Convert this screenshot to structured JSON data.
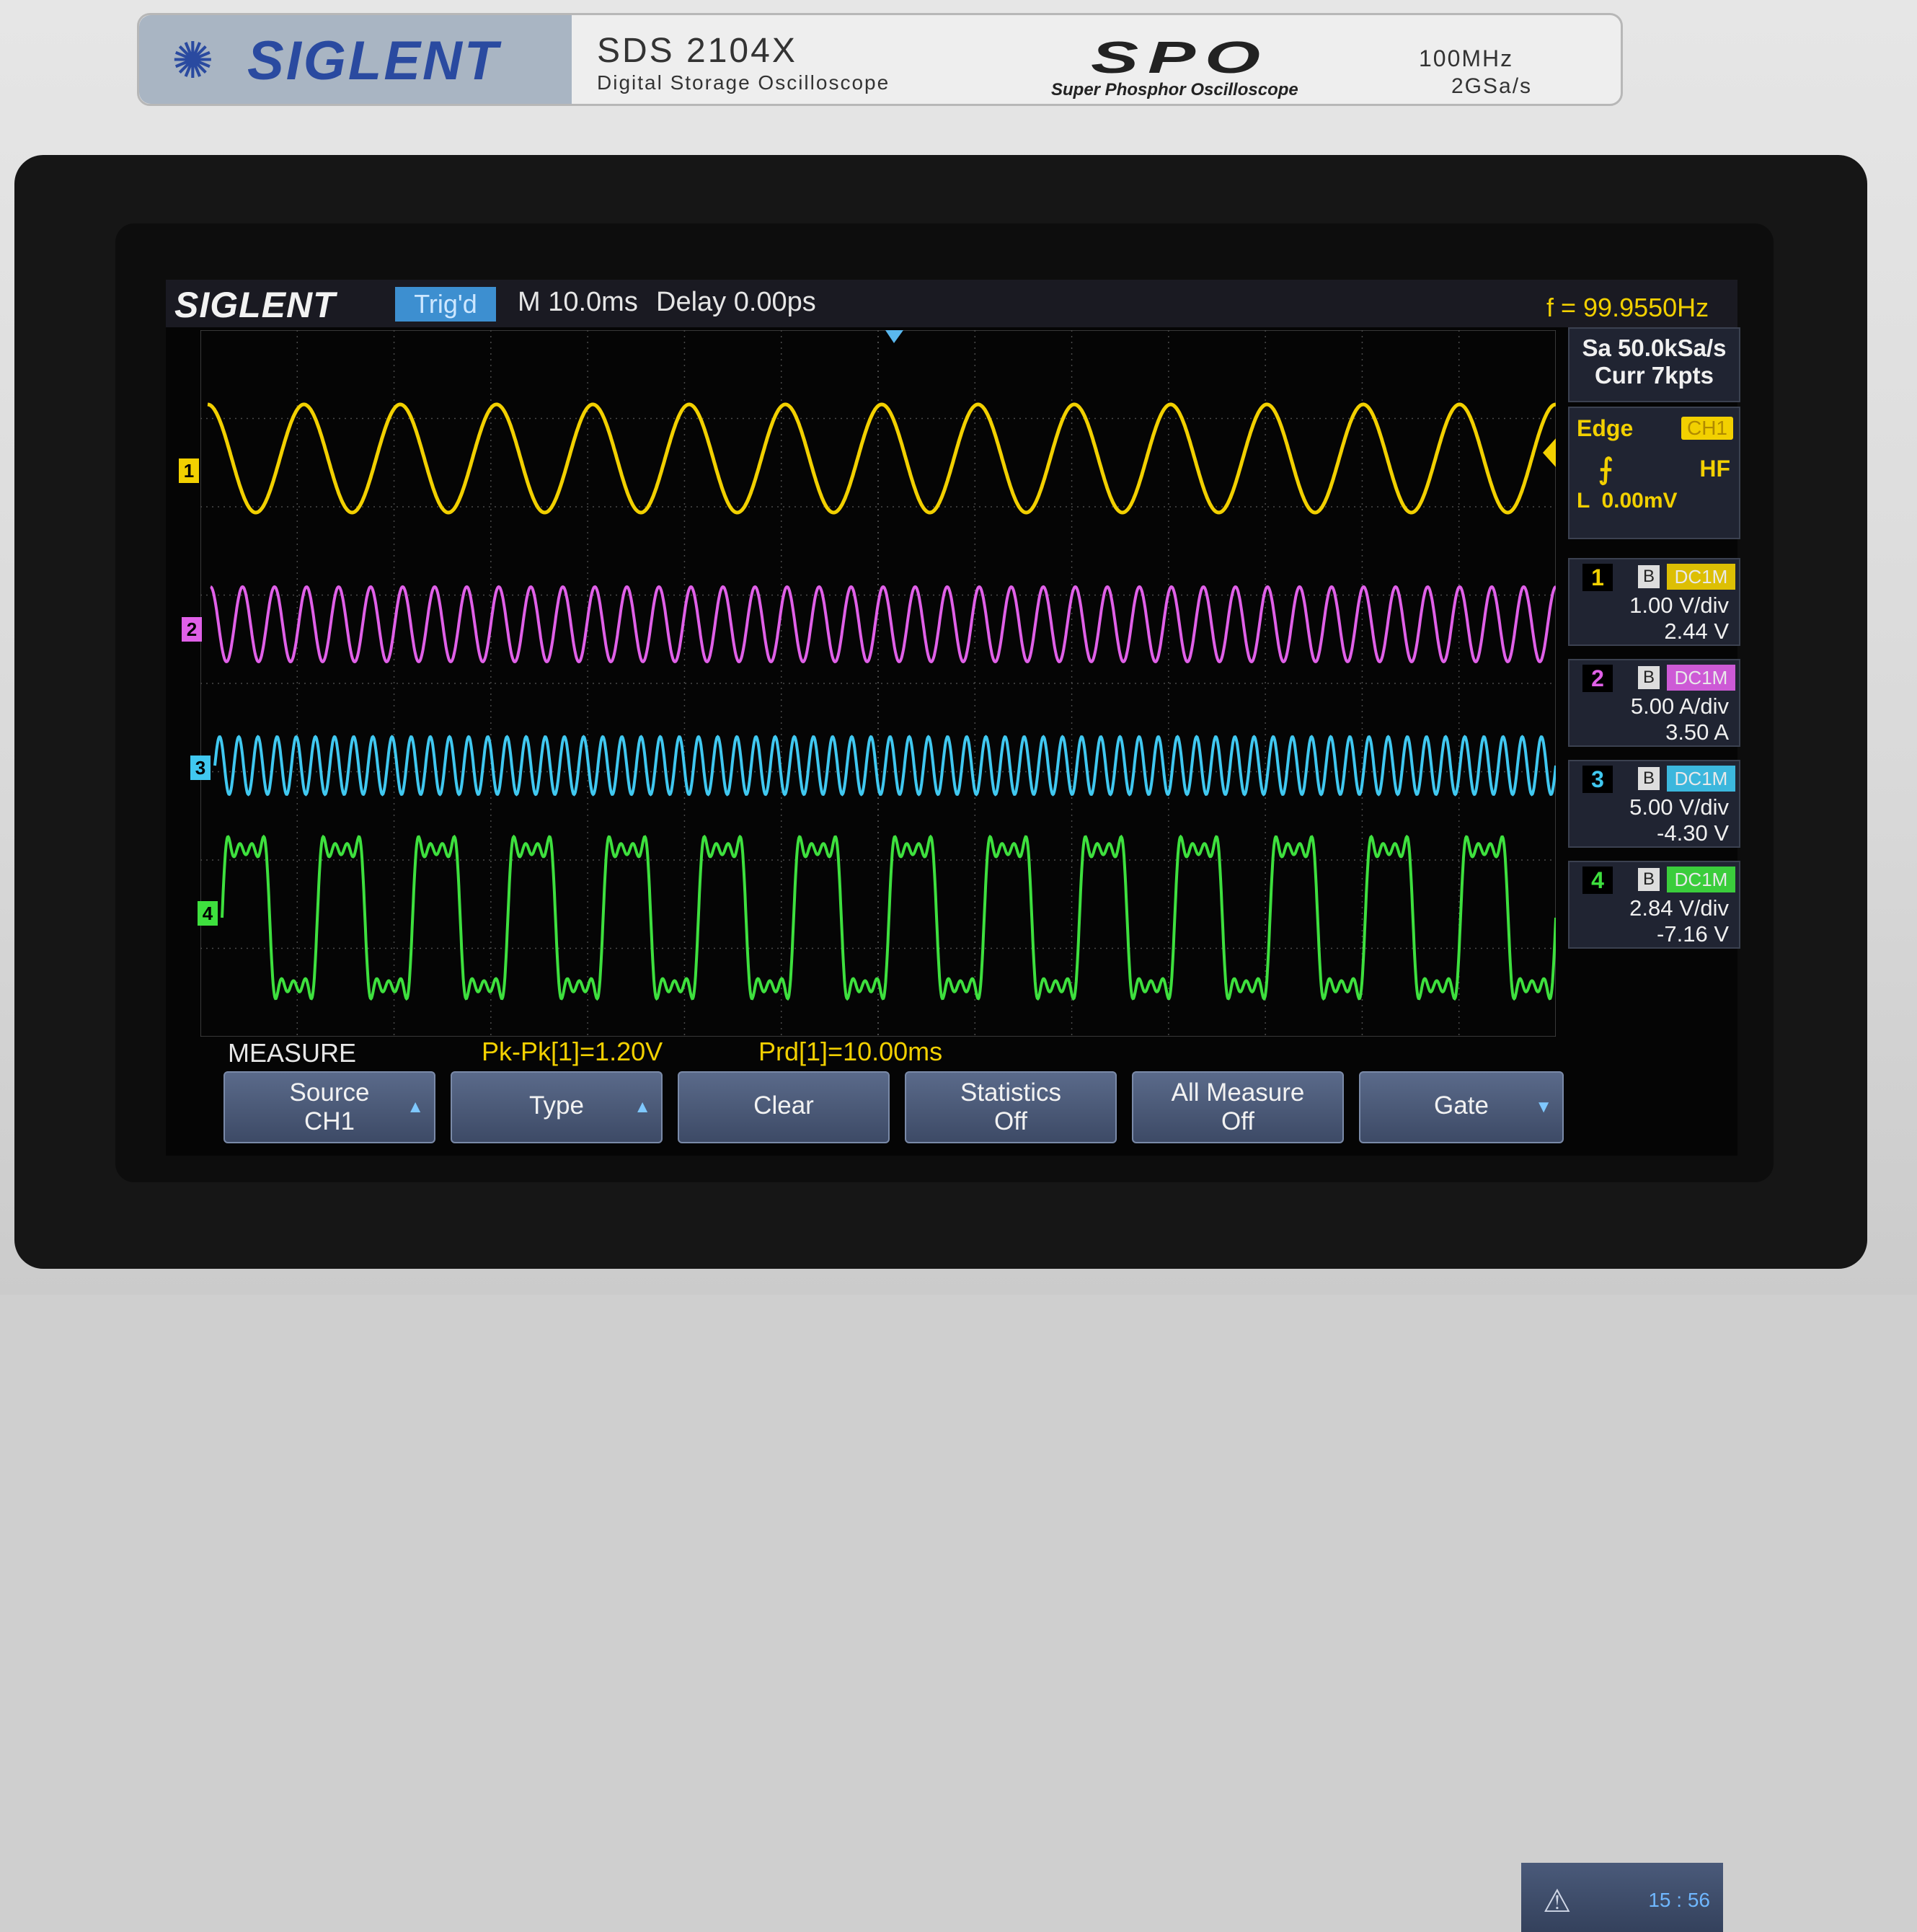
{
  "bezel": {
    "brand": "SIGLENT",
    "model": "SDS 2104X",
    "model_subtitle": "Digital Storage Oscilloscope",
    "spo": "SPO",
    "spo_tagline": "Super Phosphor Oscilloscope",
    "bandwidth": "100MHz",
    "sample_rate": "2GSa/s"
  },
  "status": {
    "logo": "SIGLENT",
    "trigger_state": "Trig'd",
    "timebase": "M 10.0ms",
    "delay": "Delay 0.00ps",
    "frequency": "f = 99.9550Hz"
  },
  "acquisition": {
    "sa": "Sa 50.0kSa/s",
    "curr": "Curr 7kpts"
  },
  "trigger": {
    "type": "Edge",
    "source": "CH1",
    "slope_icon": "rising-edge-icon",
    "coupling": "HF",
    "level": "L  0.00mV"
  },
  "channels": [
    {
      "num": "1",
      "b": "B",
      "coupling": "DC1M",
      "scale": "1.00 V/div",
      "offset": "2.44 V",
      "color": "#f2d000"
    },
    {
      "num": "2",
      "b": "B",
      "coupling": "DC1M",
      "scale": "5.00 A/div",
      "offset": "3.50 A",
      "color": "#e060e8"
    },
    {
      "num": "3",
      "b": "B",
      "coupling": "DC1M",
      "scale": "5.00 V/div",
      "offset": "-4.30 V",
      "color": "#40c8f0"
    },
    {
      "num": "4",
      "b": "B",
      "coupling": "DC1M",
      "scale": "2.84 V/div",
      "offset": "-7.16 V",
      "color": "#3ee03e"
    }
  ],
  "markers": [
    "1",
    "2",
    "3",
    "4"
  ],
  "measure": {
    "label": "MEASURE",
    "value1": "Pk-Pk[1]=1.20V",
    "value2": "Prd[1]=10.00ms"
  },
  "softkeys": [
    {
      "line1": "Source",
      "line2": "CH1",
      "arrow": true
    },
    {
      "line1": "Type",
      "line2": "",
      "arrow": true
    },
    {
      "line1": "Clear",
      "line2": "",
      "arrow": false
    },
    {
      "line1": "Statistics",
      "line2": "Off",
      "arrow": false
    },
    {
      "line1": "All Measure",
      "line2": "Off",
      "arrow": false
    },
    {
      "line1": "Gate",
      "line2": "",
      "arrow": true
    }
  ],
  "clock": "15 : 56",
  "waveforms": {
    "ch1": {
      "cycles": 14,
      "shape": "sine"
    },
    "ch2": {
      "cycles": 42,
      "shape": "sine"
    },
    "ch3": {
      "cycles": 70,
      "shape": "sine"
    },
    "ch4": {
      "cycles": 14,
      "shape": "square-odd-harmonics"
    }
  },
  "colors": {
    "ch1": "#f2d000",
    "ch2": "#e060e8",
    "ch3": "#40c8f0",
    "ch4": "#3ee03e",
    "grid": "#4a4a4a"
  }
}
